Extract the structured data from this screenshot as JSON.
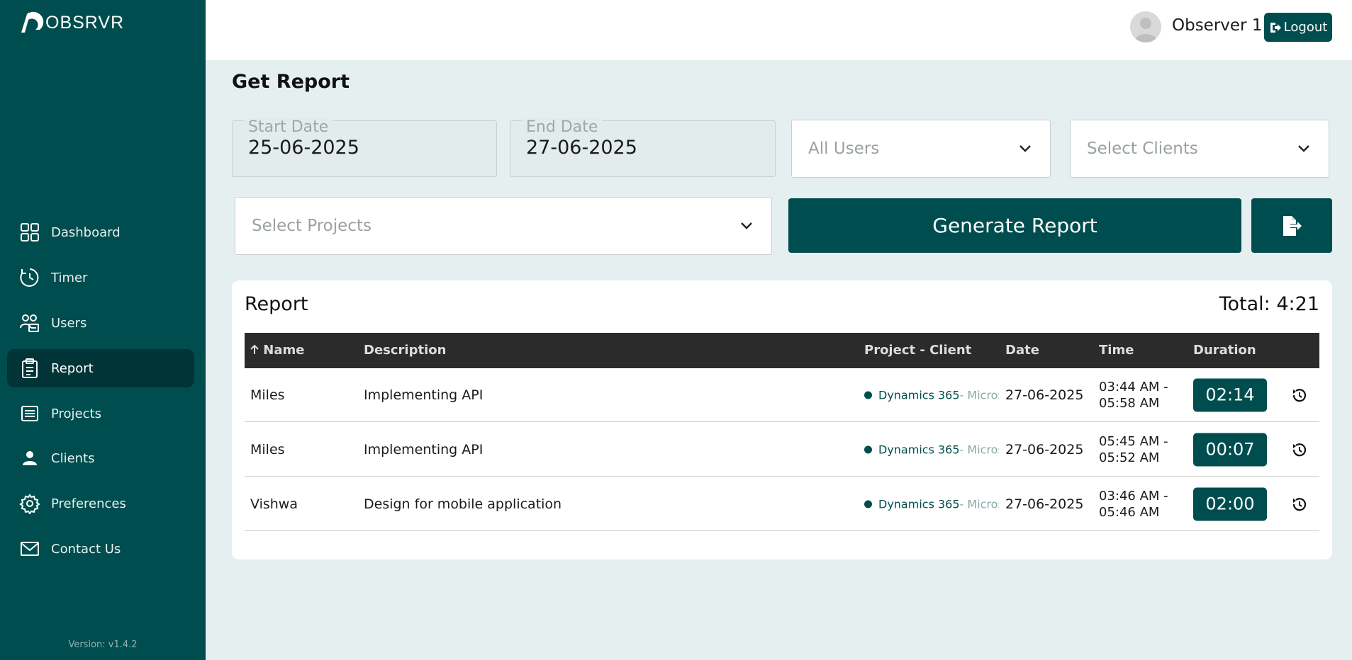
{
  "app": {
    "logo_text": "OBSRVR",
    "version": "Version: v1.4.2"
  },
  "sidebar": {
    "items": [
      {
        "label": "Dashboard",
        "icon": "grid-icon"
      },
      {
        "label": "Timer",
        "icon": "clock-icon"
      },
      {
        "label": "Users",
        "icon": "users-icon"
      },
      {
        "label": "Report",
        "icon": "clipboard-icon",
        "active": true
      },
      {
        "label": "Projects",
        "icon": "list-icon"
      },
      {
        "label": "Clients",
        "icon": "person-icon"
      },
      {
        "label": "Preferences",
        "icon": "gear-icon"
      },
      {
        "label": "Contact Us",
        "icon": "mail-icon"
      }
    ]
  },
  "header": {
    "username": "Observer 1",
    "logout_label": "Logout"
  },
  "page": {
    "title": "Get Report"
  },
  "filters": {
    "start_date_label": "Start Date",
    "start_date_value": "25-06-2025",
    "end_date_label": "End Date",
    "end_date_value": "27-06-2025",
    "users_placeholder": "All Users",
    "clients_placeholder": "Select Clients",
    "projects_placeholder": "Select Projects",
    "generate_label": "Generate Report"
  },
  "report": {
    "title": "Report",
    "total": "Total: 4:21",
    "columns": {
      "name": "Name",
      "description": "Description",
      "project_client": "Project - Client",
      "date": "Date",
      "time": "Time",
      "duration": "Duration"
    },
    "rows": [
      {
        "name": "Miles",
        "description": "Implementing API",
        "project": "Dynamics 365",
        "client": " - Microsoft",
        "date": "27-06-2025",
        "time_start": "03:44 AM -",
        "time_end": "05:58 AM",
        "duration": "02:14"
      },
      {
        "name": "Miles",
        "description": "Implementing API",
        "project": "Dynamics 365",
        "client": " - Microsoft",
        "date": "27-06-2025",
        "time_start": "05:45 AM -",
        "time_end": "05:52 AM",
        "duration": "00:07"
      },
      {
        "name": "Vishwa",
        "description": "Design for mobile application",
        "project": "Dynamics 365",
        "client": " - Microsoft",
        "date": "27-06-2025",
        "time_start": "03:46 AM -",
        "time_end": "05:46 AM",
        "duration": "02:00"
      }
    ]
  },
  "colors": {
    "brand": "#004d4f",
    "sidebar_active": "#013437",
    "background": "#e6eff0"
  }
}
